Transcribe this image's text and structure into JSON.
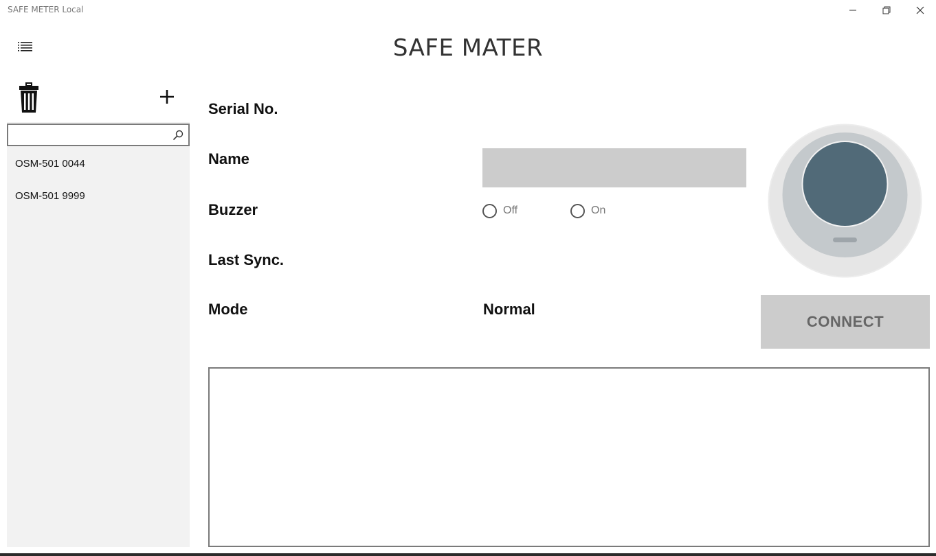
{
  "window": {
    "title": "SAFE METER Local"
  },
  "header": {
    "app_title": "SAFE MATER"
  },
  "sidebar": {
    "search": {
      "value": "",
      "placeholder": ""
    },
    "items": [
      {
        "label": "OSM-501 0044"
      },
      {
        "label": "OSM-501 9999"
      }
    ]
  },
  "details": {
    "serial_label": "Serial No.",
    "name_label": "Name",
    "name_value": "",
    "buzzer_label": "Buzzer",
    "buzzer_options": [
      {
        "label": "Off"
      },
      {
        "label": "On"
      }
    ],
    "last_sync_label": "Last Sync.",
    "mode_label": "Mode",
    "mode_value": "Normal"
  },
  "actions": {
    "connect_label": "CONNECT"
  },
  "icons": {
    "menu": "list-icon",
    "delete": "trash-icon",
    "add": "plus-icon",
    "search": "search-icon",
    "device": "device-icon"
  },
  "colors": {
    "input_bg": "#cccccc",
    "sidebar_bg": "#f2f2f2",
    "device_face": "#516a78"
  }
}
